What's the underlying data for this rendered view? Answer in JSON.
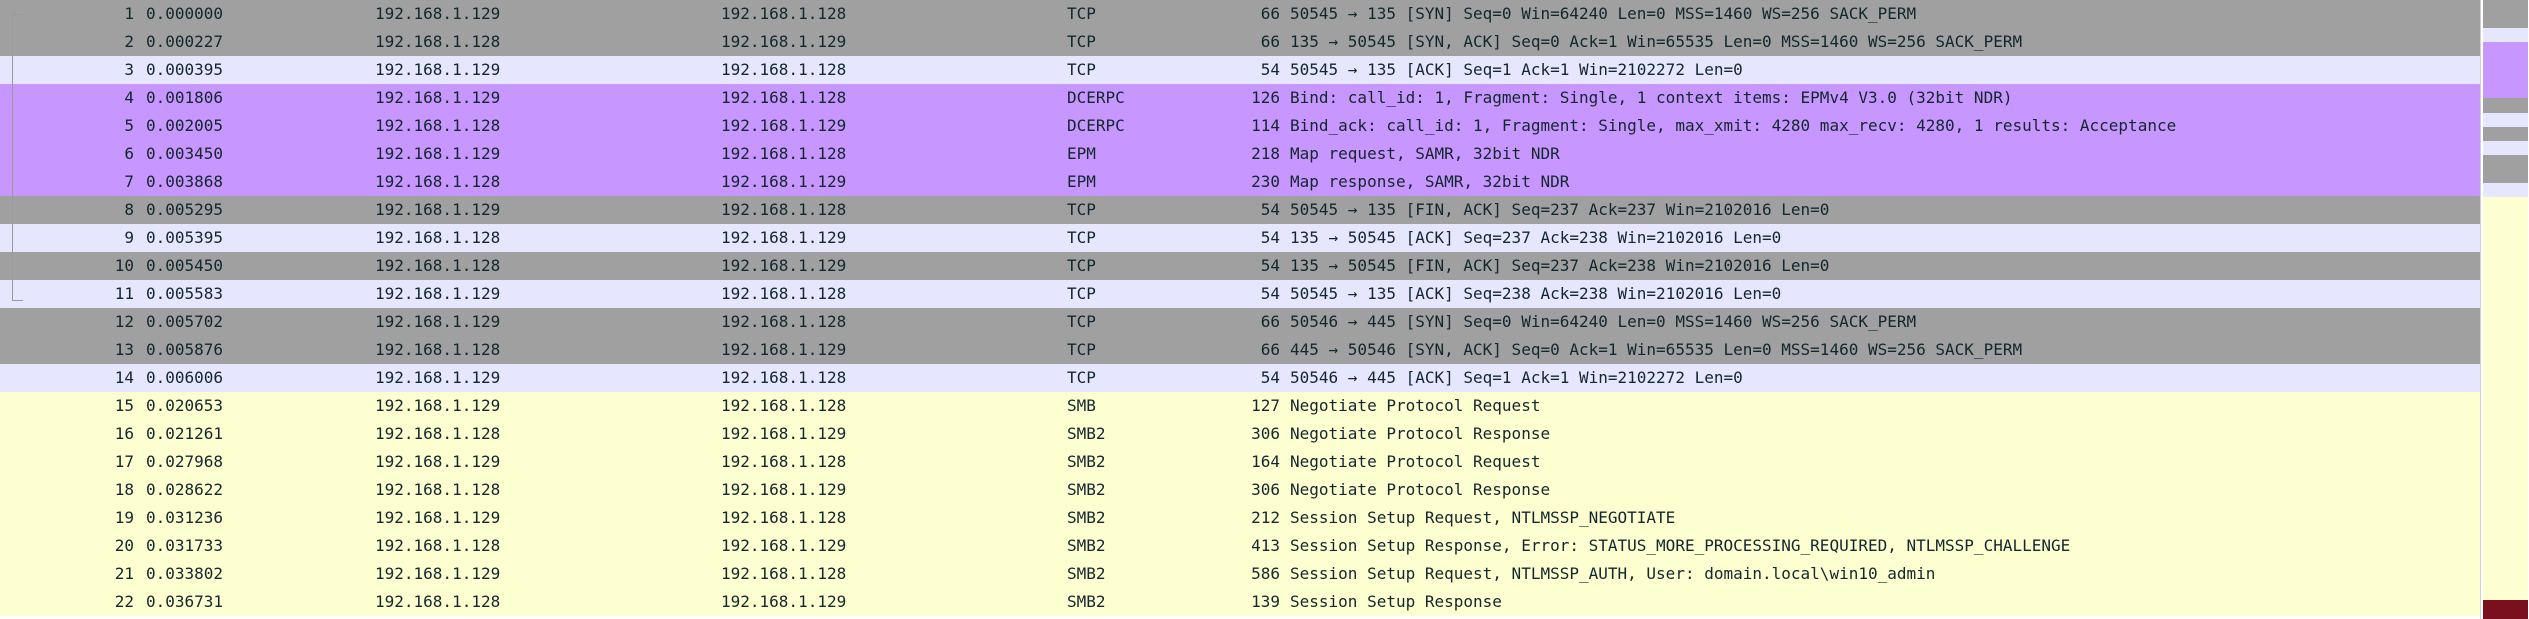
{
  "colors": {
    "tcp_syn_fin": "#a0a0a0",
    "tcp_plain": "#e7e6ff",
    "dcerpc": "#c797ff",
    "smb": "#feffd0",
    "text": "#12272e",
    "minimap_dark": "#7a0f1e"
  },
  "packets": [
    {
      "no": "1",
      "time": "0.000000",
      "src": "192.168.1.129",
      "dst": "192.168.1.128",
      "proto": "TCP",
      "len": "66",
      "info": "50545 → 135 [SYN] Seq=0 Win=64240 Len=0 MSS=1460 WS=256 SACK_PERM",
      "color": "tcp_syn_fin"
    },
    {
      "no": "2",
      "time": "0.000227",
      "src": "192.168.1.128",
      "dst": "192.168.1.129",
      "proto": "TCP",
      "len": "66",
      "info": "135 → 50545 [SYN, ACK] Seq=0 Ack=1 Win=65535 Len=0 MSS=1460 WS=256 SACK_PERM",
      "color": "tcp_syn_fin"
    },
    {
      "no": "3",
      "time": "0.000395",
      "src": "192.168.1.129",
      "dst": "192.168.1.128",
      "proto": "TCP",
      "len": "54",
      "info": "50545 → 135 [ACK] Seq=1 Ack=1 Win=2102272 Len=0",
      "color": "tcp_plain"
    },
    {
      "no": "4",
      "time": "0.001806",
      "src": "192.168.1.129",
      "dst": "192.168.1.128",
      "proto": "DCERPC",
      "len": "126",
      "info": "Bind: call_id: 1, Fragment: Single, 1 context items: EPMv4 V3.0 (32bit NDR)",
      "color": "dcerpc"
    },
    {
      "no": "5",
      "time": "0.002005",
      "src": "192.168.1.128",
      "dst": "192.168.1.129",
      "proto": "DCERPC",
      "len": "114",
      "info": "Bind_ack: call_id: 1, Fragment: Single, max_xmit: 4280 max_recv: 4280, 1 results: Acceptance",
      "color": "dcerpc"
    },
    {
      "no": "6",
      "time": "0.003450",
      "src": "192.168.1.129",
      "dst": "192.168.1.128",
      "proto": "EPM",
      "len": "218",
      "info": "Map request, SAMR, 32bit NDR",
      "color": "dcerpc"
    },
    {
      "no": "7",
      "time": "0.003868",
      "src": "192.168.1.128",
      "dst": "192.168.1.129",
      "proto": "EPM",
      "len": "230",
      "info": "Map response, SAMR, 32bit NDR",
      "color": "dcerpc"
    },
    {
      "no": "8",
      "time": "0.005295",
      "src": "192.168.1.129",
      "dst": "192.168.1.128",
      "proto": "TCP",
      "len": "54",
      "info": "50545 → 135 [FIN, ACK] Seq=237 Ack=237 Win=2102016 Len=0",
      "color": "tcp_syn_fin"
    },
    {
      "no": "9",
      "time": "0.005395",
      "src": "192.168.1.128",
      "dst": "192.168.1.129",
      "proto": "TCP",
      "len": "54",
      "info": "135 → 50545 [ACK] Seq=237 Ack=238 Win=2102016 Len=0",
      "color": "tcp_plain"
    },
    {
      "no": "10",
      "time": "0.005450",
      "src": "192.168.1.128",
      "dst": "192.168.1.129",
      "proto": "TCP",
      "len": "54",
      "info": "135 → 50545 [FIN, ACK] Seq=237 Ack=238 Win=2102016 Len=0",
      "color": "tcp_syn_fin"
    },
    {
      "no": "11",
      "time": "0.005583",
      "src": "192.168.1.129",
      "dst": "192.168.1.128",
      "proto": "TCP",
      "len": "54",
      "info": "50545 → 135 [ACK] Seq=238 Ack=238 Win=2102016 Len=0",
      "color": "tcp_plain"
    },
    {
      "no": "12",
      "time": "0.005702",
      "src": "192.168.1.129",
      "dst": "192.168.1.128",
      "proto": "TCP",
      "len": "66",
      "info": "50546 → 445 [SYN] Seq=0 Win=64240 Len=0 MSS=1460 WS=256 SACK_PERM",
      "color": "tcp_syn_fin"
    },
    {
      "no": "13",
      "time": "0.005876",
      "src": "192.168.1.128",
      "dst": "192.168.1.129",
      "proto": "TCP",
      "len": "66",
      "info": "445 → 50546 [SYN, ACK] Seq=0 Ack=1 Win=65535 Len=0 MSS=1460 WS=256 SACK_PERM",
      "color": "tcp_syn_fin"
    },
    {
      "no": "14",
      "time": "0.006006",
      "src": "192.168.1.129",
      "dst": "192.168.1.128",
      "proto": "TCP",
      "len": "54",
      "info": "50546 → 445 [ACK] Seq=1 Ack=1 Win=2102272 Len=0",
      "color": "tcp_plain"
    },
    {
      "no": "15",
      "time": "0.020653",
      "src": "192.168.1.129",
      "dst": "192.168.1.128",
      "proto": "SMB",
      "len": "127",
      "info": "Negotiate Protocol Request",
      "color": "smb"
    },
    {
      "no": "16",
      "time": "0.021261",
      "src": "192.168.1.128",
      "dst": "192.168.1.129",
      "proto": "SMB2",
      "len": "306",
      "info": "Negotiate Protocol Response",
      "color": "smb"
    },
    {
      "no": "17",
      "time": "0.027968",
      "src": "192.168.1.129",
      "dst": "192.168.1.128",
      "proto": "SMB2",
      "len": "164",
      "info": "Negotiate Protocol Request",
      "color": "smb"
    },
    {
      "no": "18",
      "time": "0.028622",
      "src": "192.168.1.128",
      "dst": "192.168.1.129",
      "proto": "SMB2",
      "len": "306",
      "info": "Negotiate Protocol Response",
      "color": "smb"
    },
    {
      "no": "19",
      "time": "0.031236",
      "src": "192.168.1.129",
      "dst": "192.168.1.128",
      "proto": "SMB2",
      "len": "212",
      "info": "Session Setup Request, NTLMSSP_NEGOTIATE",
      "color": "smb"
    },
    {
      "no": "20",
      "time": "0.031733",
      "src": "192.168.1.128",
      "dst": "192.168.1.129",
      "proto": "SMB2",
      "len": "413",
      "info": "Session Setup Response, Error: STATUS_MORE_PROCESSING_REQUIRED, NTLMSSP_CHALLENGE",
      "color": "smb"
    },
    {
      "no": "21",
      "time": "0.033802",
      "src": "192.168.1.129",
      "dst": "192.168.1.128",
      "proto": "SMB2",
      "len": "586",
      "info": "Session Setup Request, NTLMSSP_AUTH, User: domain.local\\win10_admin",
      "color": "smb"
    },
    {
      "no": "22",
      "time": "0.036731",
      "src": "192.168.1.128",
      "dst": "192.168.1.129",
      "proto": "SMB2",
      "len": "139",
      "info": "Session Setup Response",
      "color": "smb"
    }
  ]
}
